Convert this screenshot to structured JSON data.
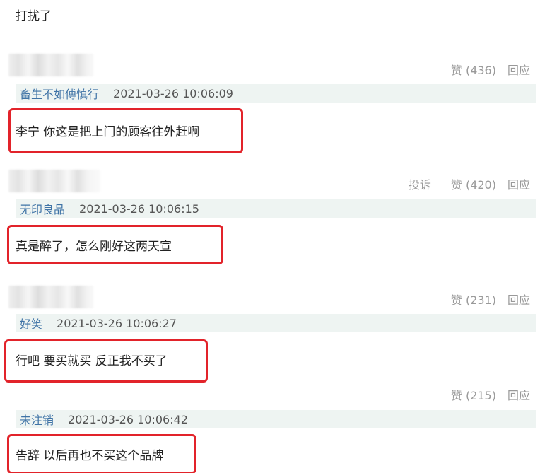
{
  "top_text": "打扰了",
  "comments": [
    {
      "actions": [
        "赞 (436)",
        "回应"
      ],
      "author": "畜生不如傅慎行",
      "time": "2021-03-26 10:06:09",
      "body": "李宁 你这是把上门的顾客往外赶啊"
    },
    {
      "actions": [
        "投诉",
        "赞 (420)",
        "回应"
      ],
      "author": "无印良品",
      "time": "2021-03-26 10:06:15",
      "body": "真是醉了，怎么刚好这两天宣"
    },
    {
      "actions": [
        "赞 (231)",
        "回应"
      ],
      "author": "好笑",
      "time": "2021-03-26 10:06:27",
      "body": "行吧 要买就买 反正我不买了"
    },
    {
      "actions": [
        "赞 (215)",
        "回应"
      ],
      "author": "未注销",
      "time": "2021-03-26 10:06:42",
      "body": "告辞 以后再也不买这个品牌"
    }
  ],
  "colors": {
    "highlight_border": "#e2232a",
    "meta_background": "#eef4f2",
    "author_link": "#3f73a6",
    "action_text": "#999999"
  }
}
